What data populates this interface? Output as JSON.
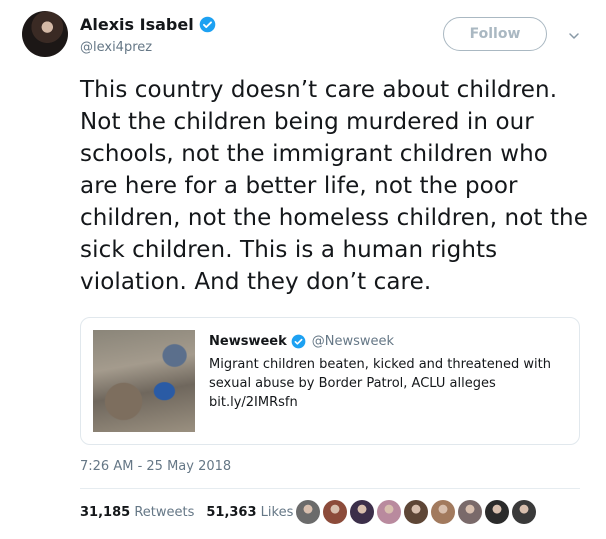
{
  "author": {
    "display_name": "Alexis Isabel",
    "handle": "@lexi4prez",
    "verified": true
  },
  "follow_label": "Follow",
  "tweet_text": "This country doesn’t care about children. Not the children being murdered in our schools, not the immigrant children who are here for a better life, not the poor children, not the homeless children, not the sick children. This is a human rights violation. And they don’t care.",
  "quoted_tweet": {
    "display_name": "Newsweek",
    "handle": "@Newsweek",
    "verified": true,
    "text": "Migrant children beaten, kicked and threatened with sexual abuse by Border Patrol, ACLU alleges bit.ly/2IMRsfn"
  },
  "timestamp": "7:26 AM - 25 May 2018",
  "stats": {
    "retweets_count": "31,185",
    "retweets_label": "Retweets",
    "likes_count": "51,363",
    "likes_label": "Likes"
  },
  "likers": [
    {
      "name": "liker-1",
      "color": "#6b6b6b"
    },
    {
      "name": "liker-2",
      "color": "#8c4b3a"
    },
    {
      "name": "liker-3",
      "color": "#3c2f4a"
    },
    {
      "name": "liker-4",
      "color": "#b98a9e"
    },
    {
      "name": "liker-5",
      "color": "#5e4636"
    },
    {
      "name": "liker-6",
      "color": "#a27a5e"
    },
    {
      "name": "liker-7",
      "color": "#7a6a6a"
    },
    {
      "name": "liker-8",
      "color": "#2b2b2b"
    },
    {
      "name": "liker-9",
      "color": "#3a3a3a"
    }
  ],
  "colors": {
    "verified_blue": "#1da1f2",
    "muted_text": "#657786",
    "follow_border": "#aab8c2"
  },
  "icons": {
    "verified": "verified-badge-icon",
    "caret": "chevron-down-icon"
  }
}
